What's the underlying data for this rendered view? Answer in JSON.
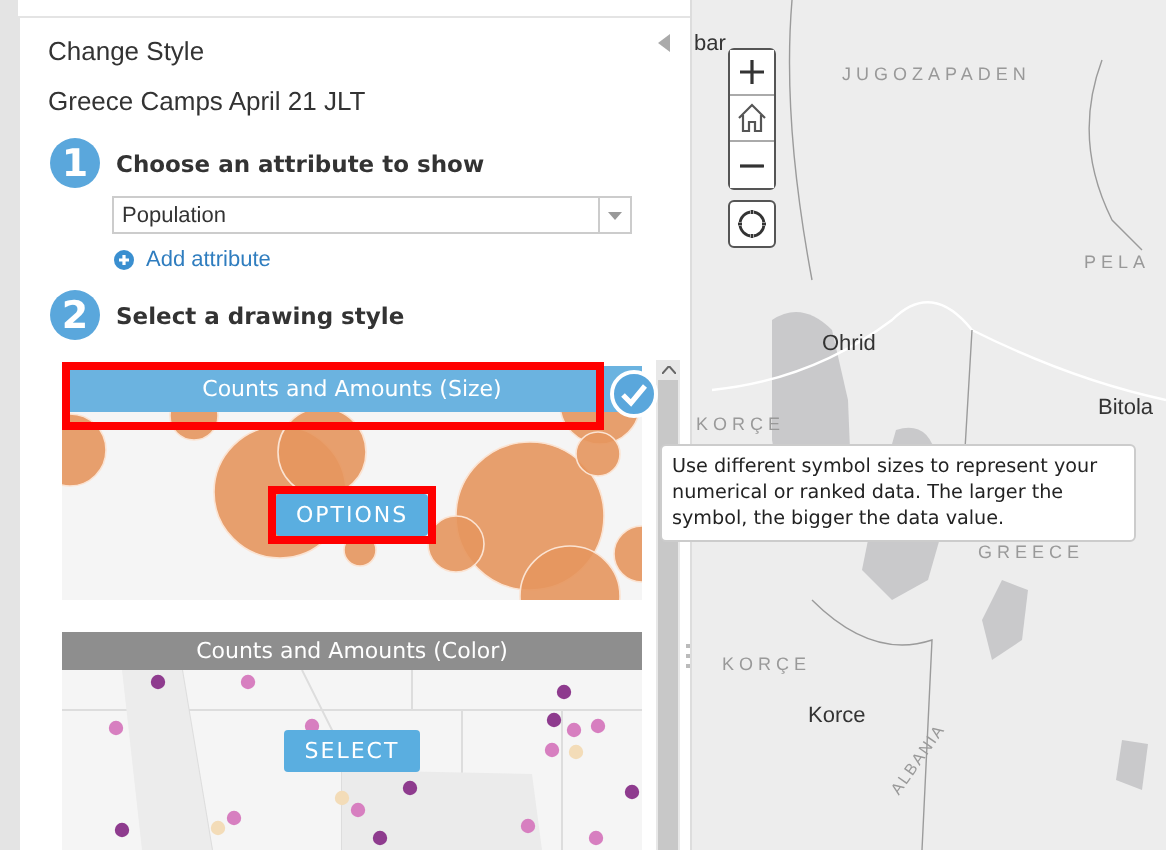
{
  "panel": {
    "title": "Change Style",
    "subtitle": "Greece Camps April 21 JLT",
    "steps": [
      {
        "number": "1",
        "label": "Choose an attribute to show"
      },
      {
        "number": "2",
        "label": "Select a drawing style"
      }
    ],
    "attribute_select": {
      "value": "Population"
    },
    "add_attribute": "Add attribute",
    "styles": [
      {
        "kind": "size",
        "title": "Counts and Amounts (Size)",
        "selected": true,
        "button": "OPTIONS"
      },
      {
        "kind": "color",
        "title": "Counts and Amounts (Color)",
        "selected": false,
        "button": "SELECT"
      }
    ]
  },
  "tooltip": "Use different symbol sizes to represent your numerical or ranked data. The larger the symbol, the bigger the data value.",
  "map": {
    "labels": [
      {
        "text": "bar",
        "kind": "city"
      },
      {
        "text": "JUGOZAPADEN",
        "kind": "region"
      },
      {
        "text": "PELA",
        "kind": "region"
      },
      {
        "text": "Ohrid",
        "kind": "city"
      },
      {
        "text": "Bitola",
        "kind": "city"
      },
      {
        "text": "KORÇE",
        "kind": "region"
      },
      {
        "text": "GREECE",
        "kind": "region"
      },
      {
        "text": "KORÇE",
        "kind": "region"
      },
      {
        "text": "Korce",
        "kind": "city"
      },
      {
        "text": "ALBANIA",
        "kind": "country"
      }
    ]
  }
}
